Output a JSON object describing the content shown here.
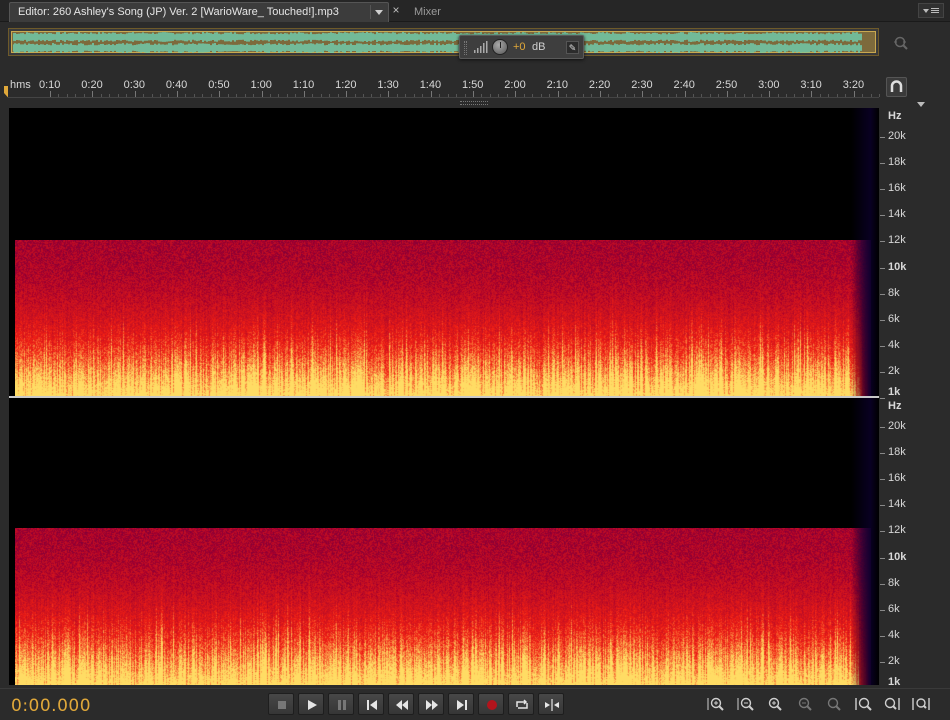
{
  "tabs": {
    "editor_label": "Editor: 260 Ashley's Song (JP) Ver. 2 [WarioWare_ Touched!].mp3",
    "mixer_label": "Mixer",
    "close_glyph": "×"
  },
  "hud": {
    "volume_value": "+0",
    "volume_unit": "dB"
  },
  "timeline": {
    "unit_label": "hms",
    "ticks": [
      "0:10",
      "0:20",
      "0:30",
      "0:40",
      "0:50",
      "1:00",
      "1:10",
      "1:20",
      "1:30",
      "1:40",
      "1:50",
      "2:00",
      "2:10",
      "2:20",
      "2:30",
      "2:40",
      "2:50",
      "3:00",
      "3:10",
      "3:20"
    ]
  },
  "frequency_axis": {
    "unit": "Hz",
    "labels": [
      "20k",
      "18k",
      "16k",
      "14k",
      "12k",
      "10k",
      "8k",
      "6k",
      "4k",
      "2k",
      "1k"
    ],
    "bold_labels": [
      "10k",
      "1k"
    ]
  },
  "transport": {
    "timecode": "0:00.000",
    "buttons": [
      "stop",
      "play",
      "pause",
      "go-to-start",
      "rewind",
      "fast-forward",
      "go-to-end",
      "record",
      "loop",
      "skip-selection"
    ]
  },
  "zoom_tools": [
    "zoom-in-amplitude",
    "zoom-out-amplitude",
    "zoom-in-time",
    "zoom-out-full",
    "zoom-to-selection",
    "zoom-in-left",
    "zoom-in-right",
    "zoom-in-horizontal"
  ],
  "colors": {
    "accent_orange": "#e0a83a",
    "spectrum_low": "#ffd36b",
    "spectrum_mid": "#d8162a",
    "spectrum_high": "#3a0b59",
    "overview_waveform": "#6fcfb0"
  }
}
